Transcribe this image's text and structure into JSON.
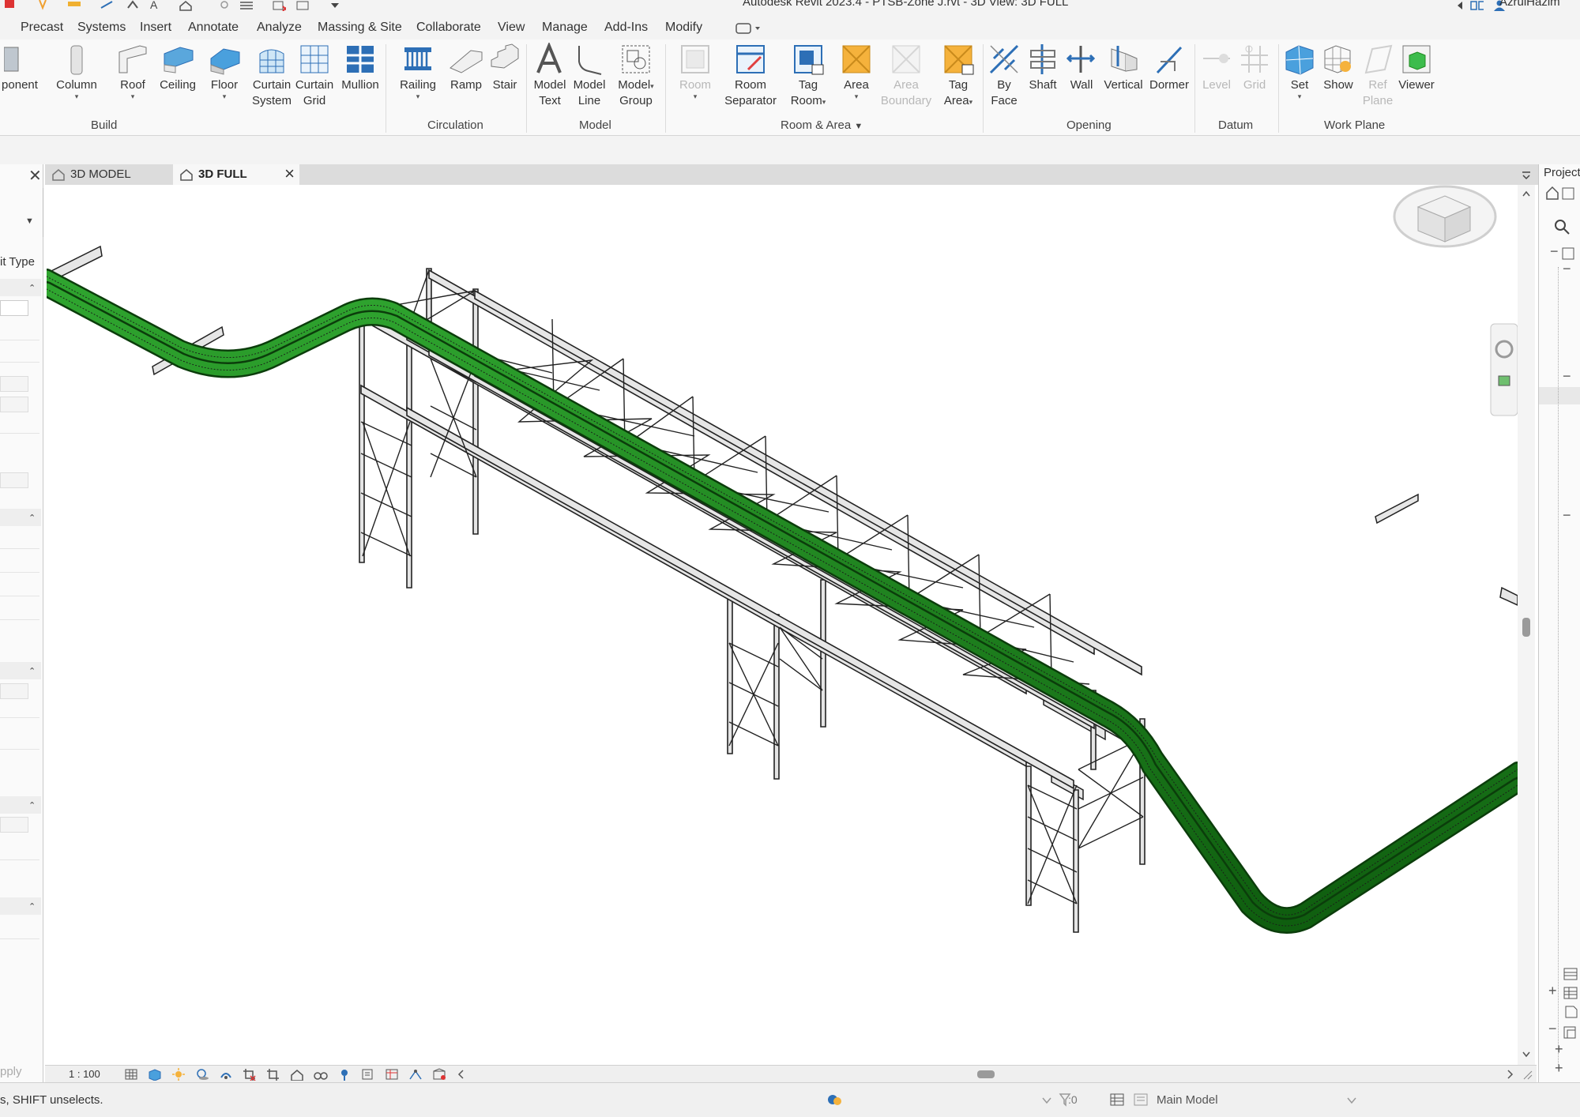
{
  "app": {
    "title": "Autodesk Revit 2023.4 - PTSB-Zone J.rvt - 3D View: 3D FULL",
    "user": "AzrulHazim"
  },
  "ribbon_tabs": [
    "Precast",
    "Systems",
    "Insert",
    "Annotate",
    "Analyze",
    "Massing & Site",
    "Collaborate",
    "View",
    "Manage",
    "Add-Ins",
    "Modify"
  ],
  "ribbon": {
    "build": {
      "label": "Build",
      "component": "ponent",
      "column": "Column",
      "roof": "Roof",
      "ceiling": "Ceiling",
      "floor": "Floor",
      "curtain_system": [
        "Curtain",
        "System"
      ],
      "curtain_grid": [
        "Curtain",
        "Grid"
      ],
      "mullion": "Mullion"
    },
    "circulation": {
      "label": "Circulation",
      "railing": "Railing",
      "ramp": "Ramp",
      "stair": "Stair"
    },
    "model": {
      "label": "Model",
      "model_text": [
        "Model",
        "Text"
      ],
      "model_line": [
        "Model",
        "Line"
      ],
      "model_group": [
        "Model",
        "Group"
      ]
    },
    "room_area": {
      "label": "Room & Area",
      "room": "Room",
      "room_separator": [
        "Room",
        "Separator"
      ],
      "tag_room": [
        "Tag",
        "Room"
      ],
      "area": "Area",
      "area_boundary": [
        "Area",
        "Boundary"
      ],
      "tag_area": [
        "Tag",
        "Area"
      ]
    },
    "opening": {
      "label": "Opening",
      "by_face": [
        "By",
        "Face"
      ],
      "shaft": "Shaft",
      "wall": "Wall",
      "vertical": "Vertical",
      "dormer": "Dormer"
    },
    "datum": {
      "label": "Datum",
      "level": "Level",
      "grid": "Grid"
    },
    "work_plane": {
      "label": "Work Plane",
      "set": "Set",
      "show": "Show",
      "ref_plane": [
        "Ref",
        "Plane"
      ],
      "viewer": "Viewer"
    }
  },
  "properties": {
    "type_label": "it Type",
    "apply": "pply"
  },
  "view_tabs": [
    {
      "label": "3D MODEL",
      "active": false
    },
    {
      "label": "3D FULL",
      "active": true
    }
  ],
  "project_browser": {
    "header": "Project"
  },
  "view_bar": {
    "scale": "1 : 100"
  },
  "status": {
    "message": "s, SHIFT unselects.",
    "selection_count": ":0",
    "model": "Main Model"
  },
  "colors": {
    "pipe": "#1f8a1f",
    "steel": "#d9d9d9",
    "steel_edge": "#222222",
    "accent_blue": "#2d6fb6",
    "accent_orange": "#f0a030"
  }
}
